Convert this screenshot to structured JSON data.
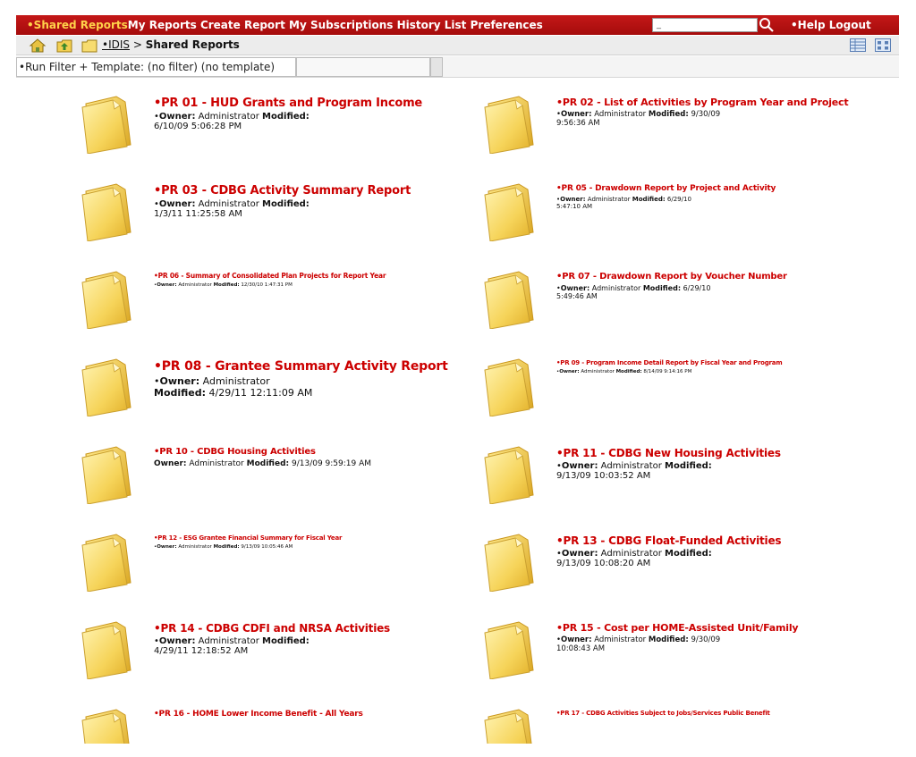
{
  "topbar": {
    "nav": [
      "•Shared Reports",
      "My Reports",
      "Create Report",
      "My Subscriptions",
      "History List",
      "Preferences"
    ],
    "search_value": "_",
    "help": "•Help",
    "logout": "Logout",
    "accent_color": "#b01010"
  },
  "breadcrumb": {
    "root": "•IDIS",
    "separator": " > ",
    "current": "Shared Reports"
  },
  "filter": {
    "label": "•Run Filter + Template: (no filter) (no template)"
  },
  "labels": {
    "owner": "Owner:",
    "modified": "Modified:"
  },
  "reports": [
    {
      "title": "•PR 01 - HUD Grants and Program Income",
      "prefix": "•",
      "owner": "Administrator",
      "modified": "6/10/09 5:06:28 PM"
    },
    {
      "title": "•PR 02 - List of Activities by Program Year and Project",
      "prefix": "•",
      "owner": "Administrator",
      "modified": "9/30/09 9:56:36 AM"
    },
    {
      "title": "•PR 03 - CDBG Activity Summary Report",
      "prefix": "•",
      "owner": "Administrator",
      "modified": "1/3/11 11:25:58 AM"
    },
    {
      "title": "•PR 05 - Drawdown Report by Project and Activity",
      "prefix": "•",
      "owner": "Administrator",
      "modified": "6/29/10 5:47:10 AM"
    },
    {
      "title": "•PR 06 - Summary of Consolidated Plan Projects for Report Year",
      "prefix": "•",
      "owner": "Administrator",
      "modified": "12/30/10 1:47:31 PM"
    },
    {
      "title": "•PR 07 - Drawdown Report by Voucher Number",
      "prefix": "•",
      "owner": "Administrator",
      "modified": "6/29/10 5:49:46 AM"
    },
    {
      "title": "•PR 08 - Grantee Summary Activity Report",
      "prefix": "•",
      "owner": "Administrator",
      "modified": "4/29/11 12:11:09 AM"
    },
    {
      "title": "•PR 09 - Program Income Detail Report by Fiscal Year and Program",
      "prefix": "•",
      "owner": "Administrator",
      "modified": "8/14/09 9:14:16 PM"
    },
    {
      "title": "•PR 10 - CDBG Housing Activities",
      "prefix": "",
      "owner": "Administrator",
      "modified": "9/13/09 9:59:19 AM"
    },
    {
      "title": "•PR 11 - CDBG New Housing Activities",
      "prefix": "•",
      "owner": "Administrator",
      "modified": "9/13/09 10:03:52 AM"
    },
    {
      "title": "•PR 12 - ESG Grantee Financial Summary for Fiscal Year",
      "prefix": "•",
      "owner": "Administrator",
      "modified": "9/13/09 10:05:46 AM"
    },
    {
      "title": "•PR 13 - CDBG Float-Funded Activities",
      "prefix": "•",
      "owner": "Administrator",
      "modified": "9/13/09 10:08:20 AM"
    },
    {
      "title": "•PR 14 - CDBG CDFI and NRSA Activities",
      "prefix": "•",
      "owner": "Administrator",
      "modified": "4/29/11 12:18:52 AM"
    },
    {
      "title": "•PR 15 - Cost per HOME-Assisted Unit/Family",
      "prefix": "•",
      "owner": "Administrator",
      "modified": "9/30/09 10:08:43 AM"
    },
    {
      "title": "•PR 16 - HOME Lower Income Benefit - All Years",
      "prefix": "•",
      "owner": "",
      "modified": ""
    },
    {
      "title": "•PR 17 - CDBG Activities Subject to Jobs/Services Public Benefit",
      "prefix": "",
      "owner": "",
      "modified": ""
    }
  ]
}
